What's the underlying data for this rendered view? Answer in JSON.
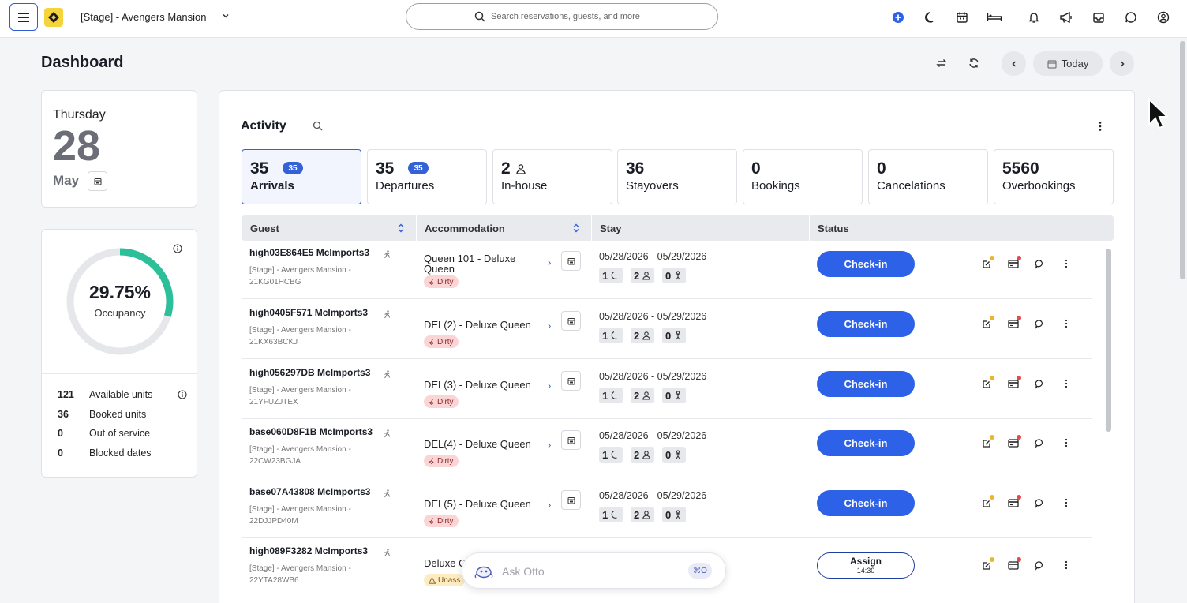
{
  "header": {
    "property_name": "[Stage] - Avengers Mansion",
    "search_placeholder": "Search reservations, guests, and more",
    "icons": [
      "plus-circle-icon",
      "moon-icon",
      "calendar-icon",
      "bed-icon",
      "bell-icon",
      "megaphone-icon",
      "inbox-icon",
      "chat-icon",
      "user-circle-icon"
    ],
    "accent_color": "#2d62e8",
    "logo_color": "#f5d33b"
  },
  "page": {
    "title": "Dashboard",
    "today_label": "Today"
  },
  "date_card": {
    "weekday": "Thursday",
    "day": "28",
    "month": "May"
  },
  "occupancy": {
    "percent_text": "29.75%",
    "percent_value": 29.75,
    "label": "Occupancy",
    "rows": [
      {
        "value": "121",
        "label": "Available units"
      },
      {
        "value": "36",
        "label": "Booked units"
      },
      {
        "value": "0",
        "label": "Out of service"
      },
      {
        "value": "0",
        "label": "Blocked dates"
      }
    ]
  },
  "activity": {
    "title": "Activity",
    "stats": [
      {
        "value": "35",
        "badge": "35",
        "label": "Arrivals"
      },
      {
        "value": "35",
        "badge": "35",
        "label": "Departures"
      },
      {
        "value": "2",
        "label": "In-house"
      },
      {
        "value": "36",
        "label": "Stayovers"
      },
      {
        "value": "0",
        "label": "Bookings"
      },
      {
        "value": "0",
        "label": "Cancelations"
      },
      {
        "value": "5560",
        "label": "Overbookings"
      }
    ],
    "columns": [
      "Guest",
      "Accommodation",
      "Stay",
      "Status"
    ],
    "rows": [
      {
        "guest": "high03E864E5 McImports3",
        "property": "[Stage] - Avengers Mansion -",
        "code": "21KG01HCBG",
        "acc_line1": "Queen 101 - Deluxe",
        "acc_line2": "Queen",
        "tag": "Dirty",
        "dates": "05/28/2026 - 05/29/2026",
        "nights": "1",
        "adults": "2",
        "children": "0",
        "status": "Check-in"
      },
      {
        "guest": "high0405F571 McImports3",
        "property": "[Stage] - Avengers Mansion -",
        "code": "21KX63BCKJ",
        "acc_line1": "DEL(2) - Deluxe Queen",
        "acc_line2": "",
        "tag": "Dirty",
        "dates": "05/28/2026 - 05/29/2026",
        "nights": "1",
        "adults": "2",
        "children": "0",
        "status": "Check-in"
      },
      {
        "guest": "high056297DB McImports3",
        "property": "[Stage] - Avengers Mansion -",
        "code": "21YFUZJTEX",
        "acc_line1": "DEL(3) - Deluxe Queen",
        "acc_line2": "",
        "tag": "Dirty",
        "dates": "05/28/2026 - 05/29/2026",
        "nights": "1",
        "adults": "2",
        "children": "0",
        "status": "Check-in"
      },
      {
        "guest": "base060D8F1B McImports3",
        "property": "[Stage] - Avengers Mansion -",
        "code": "22CW23BGJA",
        "acc_line1": "DEL(4) - Deluxe Queen",
        "acc_line2": "",
        "tag": "Dirty",
        "dates": "05/28/2026 - 05/29/2026",
        "nights": "1",
        "adults": "2",
        "children": "0",
        "status": "Check-in"
      },
      {
        "guest": "base07A43808 McImports3",
        "property": "[Stage] - Avengers Mansion -",
        "code": "22DJJPD40M",
        "acc_line1": "DEL(5) - Deluxe Queen",
        "acc_line2": "",
        "tag": "Dirty",
        "dates": "05/28/2026 - 05/29/2026",
        "nights": "1",
        "adults": "2",
        "children": "0",
        "status": "Check-in"
      },
      {
        "guest": "high089F3282 McImports3",
        "property": "[Stage] - Avengers Mansion -",
        "code": "22YTA28WB6",
        "acc_line1": "Deluxe Q",
        "acc_line2": "",
        "tag": "Unass",
        "status": "Assign",
        "status_time": "14:30"
      }
    ]
  },
  "otto": {
    "placeholder": "Ask Otto",
    "shortcut": "⌘O"
  }
}
